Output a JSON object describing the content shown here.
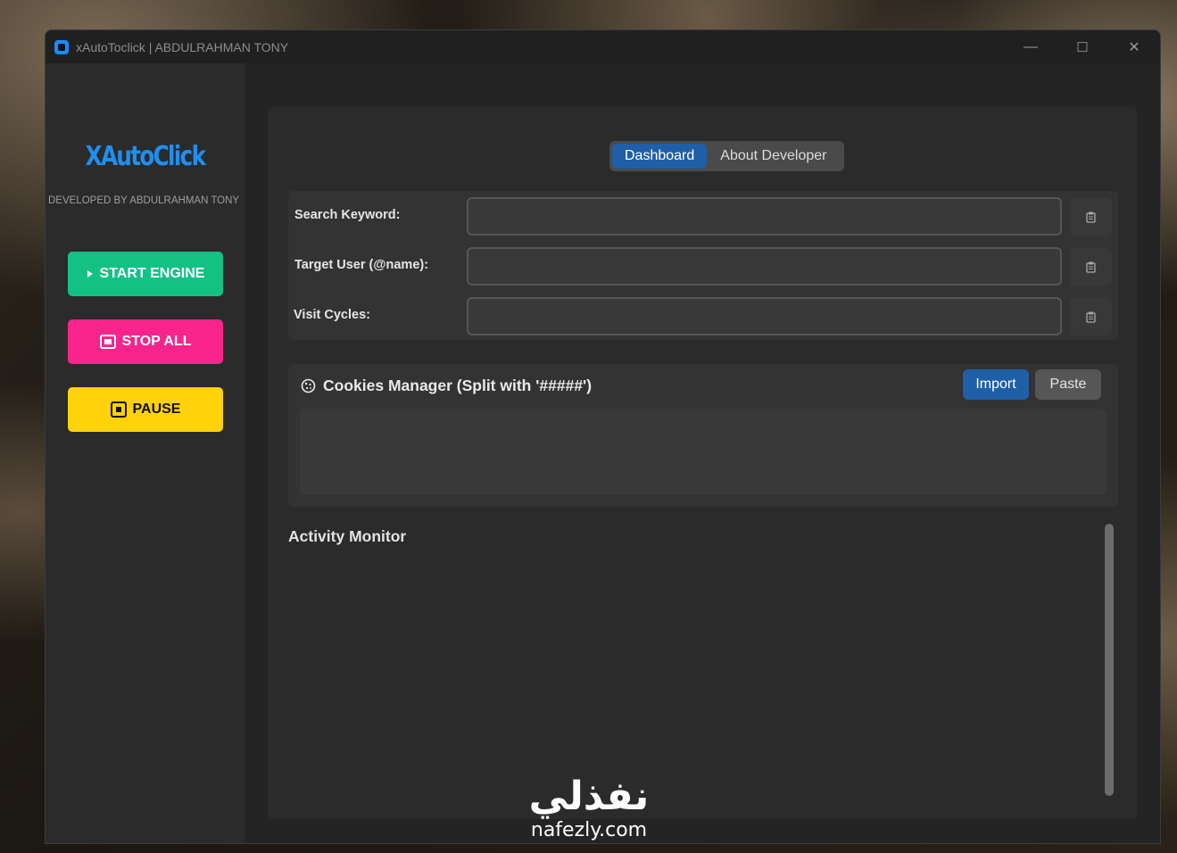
{
  "window": {
    "title": "xAutoToclick | ABDULRAHMAN TONY",
    "controls": {
      "minimize": "—",
      "maximize": "☐",
      "close": "✕"
    }
  },
  "sidebar": {
    "brand": "XAutoClick",
    "developed_by": "DEVELOPED BY ABDULRAHMAN TONY",
    "buttons": {
      "start": {
        "label": "START ENGINE",
        "icon": "play-icon",
        "color": "#13c184"
      },
      "stop": {
        "label": "STOP ALL",
        "icon": "stop-square-icon",
        "color": "#f7248b"
      },
      "pause": {
        "label": "PAUSE",
        "icon": "pause-square-icon",
        "color": "#ffd20a"
      }
    }
  },
  "tabs": [
    {
      "label": "Dashboard",
      "active": true
    },
    {
      "label": "About Developer",
      "active": false
    }
  ],
  "form": {
    "fields": [
      {
        "label": "Search Keyword:",
        "value": "",
        "paste_icon": "clipboard-icon"
      },
      {
        "label": "Target User (@name):",
        "value": "",
        "paste_icon": "clipboard-icon"
      },
      {
        "label": "Visit Cycles:",
        "value": "",
        "paste_icon": "clipboard-icon"
      }
    ]
  },
  "cookies": {
    "title": "Cookies Manager (Split with '#####')",
    "icon": "cookie-icon",
    "import_label": "Import",
    "paste_label": "Paste",
    "content": ""
  },
  "activity": {
    "title": "Activity Monitor",
    "log": ""
  },
  "watermark": {
    "arabic": "نفذلي",
    "domain": "nafezly.com"
  },
  "colors": {
    "accent": "#1f5fa8",
    "brand": "#1f8ff0"
  }
}
